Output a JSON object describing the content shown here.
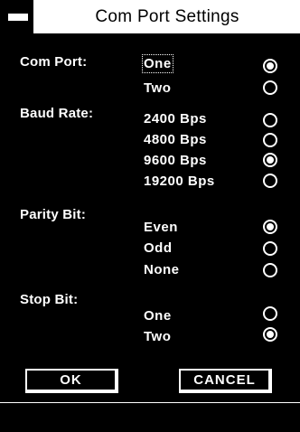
{
  "window": {
    "title": "Com Port Settings",
    "system_menu_icon": "minus-bar-icon"
  },
  "groups": {
    "com_port": {
      "label": "Com Port:",
      "options": [
        {
          "label": "One",
          "selected": true
        },
        {
          "label": "Two",
          "selected": false
        }
      ]
    },
    "baud_rate": {
      "label": "Baud Rate:",
      "options": [
        {
          "label": "2400 Bps",
          "selected": false
        },
        {
          "label": "4800 Bps",
          "selected": false
        },
        {
          "label": "9600 Bps",
          "selected": true
        },
        {
          "label": "19200 Bps",
          "selected": false
        }
      ]
    },
    "parity_bit": {
      "label": "Parity Bit:",
      "options": [
        {
          "label": "Even",
          "selected": true
        },
        {
          "label": "Odd",
          "selected": false
        },
        {
          "label": "None",
          "selected": false
        }
      ]
    },
    "stop_bit": {
      "label": "Stop Bit:",
      "options": [
        {
          "label": "One",
          "selected": false
        },
        {
          "label": "Two",
          "selected": true
        }
      ]
    }
  },
  "buttons": {
    "ok": "OK",
    "cancel": "CANCEL"
  }
}
